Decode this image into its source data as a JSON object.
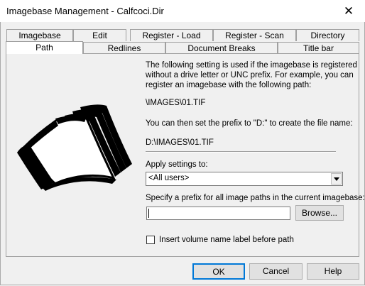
{
  "window": {
    "title": "Imagebase Management - Calfcoci.Dir",
    "close_glyph": "✕"
  },
  "tabs_row_back": [
    {
      "label": "Imagebase"
    },
    {
      "label": "Edit"
    },
    {
      "label": "Register - Load"
    },
    {
      "label": "Register - Scan"
    },
    {
      "label": "Directory"
    }
  ],
  "tabs_row_front": [
    {
      "label": "Path",
      "active": true
    },
    {
      "label": "Redlines"
    },
    {
      "label": "Document Breaks"
    },
    {
      "label": "Title bar"
    }
  ],
  "panel": {
    "illustration": "stack-of-pages-icon",
    "description_lines": [
      "The following setting is used if the imagebase is registered",
      "without a drive letter or UNC prefix.  For example, you can",
      "register an imagebase with the following path:"
    ],
    "example_path": "\\IMAGES\\01.TIF",
    "prefix_note": "You can then set the prefix to \"D:\" to create the file name:",
    "resulting_path": "D:\\IMAGES\\01.TIF",
    "apply_label": "Apply settings to:",
    "apply_value": "<All users>",
    "prefix_label": "Specify a prefix for all image paths in the current imagebase:",
    "prefix_value": "",
    "browse_label": "Browse...",
    "volume_checkbox_label": "Insert volume name label before path",
    "volume_checked": false
  },
  "buttons": {
    "ok": "OK",
    "cancel": "Cancel",
    "help": "Help"
  }
}
